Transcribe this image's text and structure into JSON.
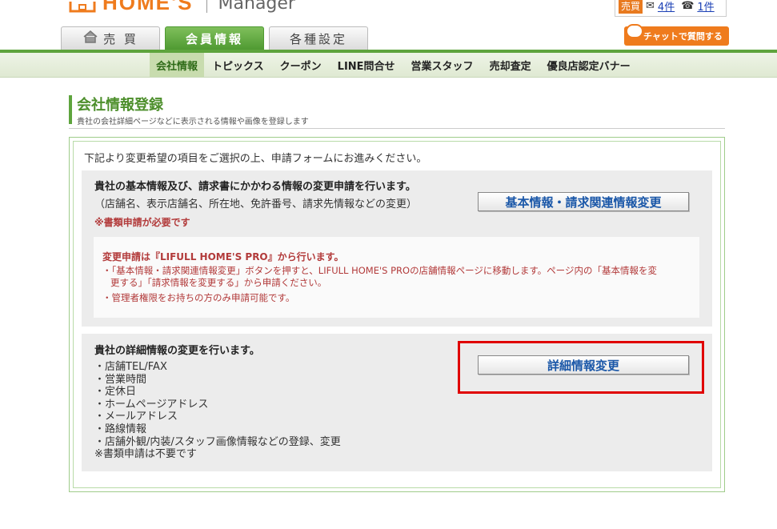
{
  "header": {
    "logo_text": "HOME'S",
    "logo_sub": "Manager",
    "sell_badge": "売買",
    "mail_icon": "envelope-icon",
    "mail_count": "4件",
    "phone_icon": "phone-icon",
    "phone_count": "1件",
    "chat_button": "チャットで質問する"
  },
  "tabs": [
    {
      "label": "売 買",
      "icon": "house-icon"
    },
    {
      "label": "会員情報"
    },
    {
      "label": "各種設定"
    }
  ],
  "subnav": [
    "会社情報",
    "トピックス",
    "クーポン",
    "LINE問合せ",
    "営業スタッフ",
    "売却査定",
    "優良店認定バナー"
  ],
  "page": {
    "title": "会社情報登録",
    "subtitle": "貴社の会社詳細ページなどに表示される情報や画像を登録します",
    "intro": "下記より変更希望の項目をご選択の上、申請フォームにお進みください。"
  },
  "section1": {
    "title": "貴社の基本情報及び、請求書にかかわる情報の変更申請を行います。",
    "desc": "（店舗名、表示店舗名、所在地、免許番号、請求先情報などの変更）",
    "note": "※書類申請が必要です",
    "button": "基本情報・請求関連情報変更",
    "notice_title": "変更申請は『LIFULL HOME'S PRO』から行います。",
    "notice_line1a": "・「基本情報・請求関連情報変更」ボタンを押すと、LIFULL HOME'S PROの店舗情報ページに移動します。ページ内の「基本情報を変",
    "notice_line1b": "更する」「請求情報を変更する」から申請ください。",
    "notice_line2": "・管理者権限をお持ちの方のみ申請可能です。"
  },
  "section2": {
    "title": "貴社の詳細情報の変更を行います。",
    "items": [
      "・店舗TEL/FAX",
      "・営業時間",
      "・定休日",
      "・ホームページアドレス",
      "・メールアドレス",
      "・路線情報",
      "・店舗外観/内装/スタッフ画像情報などの登録、変更"
    ],
    "note": "※書類申請は不要です",
    "button": "詳細情報変更"
  },
  "colors": {
    "brand_orange": "#ef7b1d",
    "brand_green": "#5ea43d",
    "link_blue": "#1a57a8",
    "notice_red": "#b23a3a",
    "highlight_red": "#e00000"
  }
}
